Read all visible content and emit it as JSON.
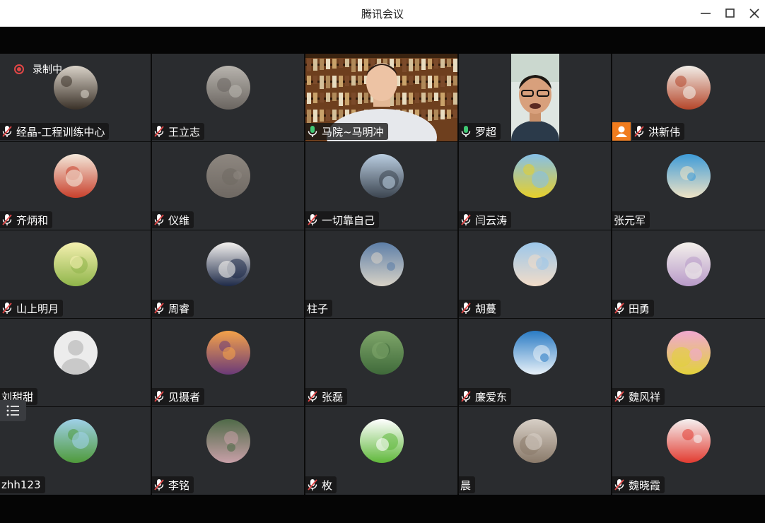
{
  "window": {
    "title": "腾讯会议",
    "minimize_glyph": "minimize-icon",
    "maximize_glyph": "maximize-icon",
    "close_glyph": "close-icon"
  },
  "recording": {
    "label": "录制中"
  },
  "accent": {
    "active_speaker": "#19b868",
    "recording": "#e04646",
    "host_badge": "#f07c1e",
    "mic_on": "#3fc873"
  },
  "participants": [
    {
      "name": "经晶-工程训练中心",
      "mic": "muted",
      "avatar": "cat-photo",
      "colors": [
        "#d9d2c8",
        "#3a3128"
      ]
    },
    {
      "name": "王立志",
      "mic": "muted",
      "avatar": "stone-tablet",
      "colors": [
        "#b8b4ae",
        "#6a6560"
      ]
    },
    {
      "name": "马院~马明冲",
      "mic": "on",
      "avatar": "video-man-bookshelf",
      "video": true
    },
    {
      "name": "罗超",
      "mic": "on",
      "avatar": "video-man-glasses",
      "video": true,
      "active": true
    },
    {
      "name": "洪新伟",
      "mic": "muted",
      "avatar": "mountain-painting",
      "colors": [
        "#f1eee8",
        "#b5462a"
      ],
      "host": true
    },
    {
      "name": "齐炳和",
      "mic": "muted",
      "avatar": "fruit-plate",
      "colors": [
        "#f4e8da",
        "#c8402c"
      ]
    },
    {
      "name": "仪维",
      "mic": "muted",
      "avatar": "grey-texture",
      "colors": [
        "#8e8780",
        "#6f6963"
      ]
    },
    {
      "name": "一切靠自己",
      "mic": "muted",
      "avatar": "eiffel-tower",
      "colors": [
        "#b9cde0",
        "#3c4550"
      ]
    },
    {
      "name": "闫云涛",
      "mic": "muted",
      "avatar": "rapeseed-field",
      "colors": [
        "#86c0e8",
        "#e6cf2a"
      ]
    },
    {
      "name": "张元军",
      "mic": "none",
      "avatar": "beach-coast",
      "colors": [
        "#3e9bd8",
        "#efe3c5"
      ]
    },
    {
      "name": "山上明月",
      "mic": "muted",
      "avatar": "daisy-flowers",
      "colors": [
        "#f5f0b0",
        "#8fb54a"
      ]
    },
    {
      "name": "周睿",
      "mic": "muted",
      "avatar": "anime-character",
      "colors": [
        "#f3f1ef",
        "#1e2a48"
      ]
    },
    {
      "name": "柱子",
      "mic": "none",
      "avatar": "lake-mountain",
      "colors": [
        "#5d7fa8",
        "#d8d2c6"
      ]
    },
    {
      "name": "胡蔓",
      "mic": "muted",
      "avatar": "woman-portrait",
      "colors": [
        "#9cc7ea",
        "#f2dcc8"
      ]
    },
    {
      "name": "田勇",
      "mic": "muted",
      "avatar": "wisteria-flowers",
      "colors": [
        "#f4f1ec",
        "#b89ac8"
      ]
    },
    {
      "name": "刘甜甜",
      "mic": "none",
      "avatar": "default-user",
      "colors": [
        "#e5e5e5",
        "#c4c4c4"
      ]
    },
    {
      "name": "见摄者",
      "mic": "muted",
      "avatar": "sunset-tower",
      "colors": [
        "#f4a24a",
        "#6a3a78"
      ]
    },
    {
      "name": "张磊",
      "mic": "muted",
      "avatar": "lotus-leaf",
      "colors": [
        "#7fa66a",
        "#3f6a3a"
      ]
    },
    {
      "name": "廉爱东",
      "mic": "muted",
      "avatar": "badminton",
      "colors": [
        "#2a7bc4",
        "#e8f1f8"
      ]
    },
    {
      "name": "魏风祥",
      "mic": "muted",
      "avatar": "child-yellow",
      "colors": [
        "#f0a8d0",
        "#e2d23a"
      ]
    },
    {
      "name": "zhh123",
      "mic": "none",
      "avatar": "green-terraces",
      "colors": [
        "#9fd0e8",
        "#4f9a3a"
      ]
    },
    {
      "name": "李铭",
      "mic": "muted",
      "avatar": "flower-bush",
      "colors": [
        "#4f6a48",
        "#c8a0a8"
      ]
    },
    {
      "name": "枚",
      "mic": "muted",
      "avatar": "green-frog",
      "colors": [
        "#ffffff",
        "#5fb83a"
      ]
    },
    {
      "name": "晨",
      "mic": "none",
      "avatar": "person-sitting",
      "colors": [
        "#d7cfc6",
        "#8a7a6a"
      ]
    },
    {
      "name": "魏晓霞",
      "mic": "muted",
      "avatar": "red-flower",
      "colors": [
        "#f5f0f0",
        "#e23b30"
      ]
    }
  ]
}
